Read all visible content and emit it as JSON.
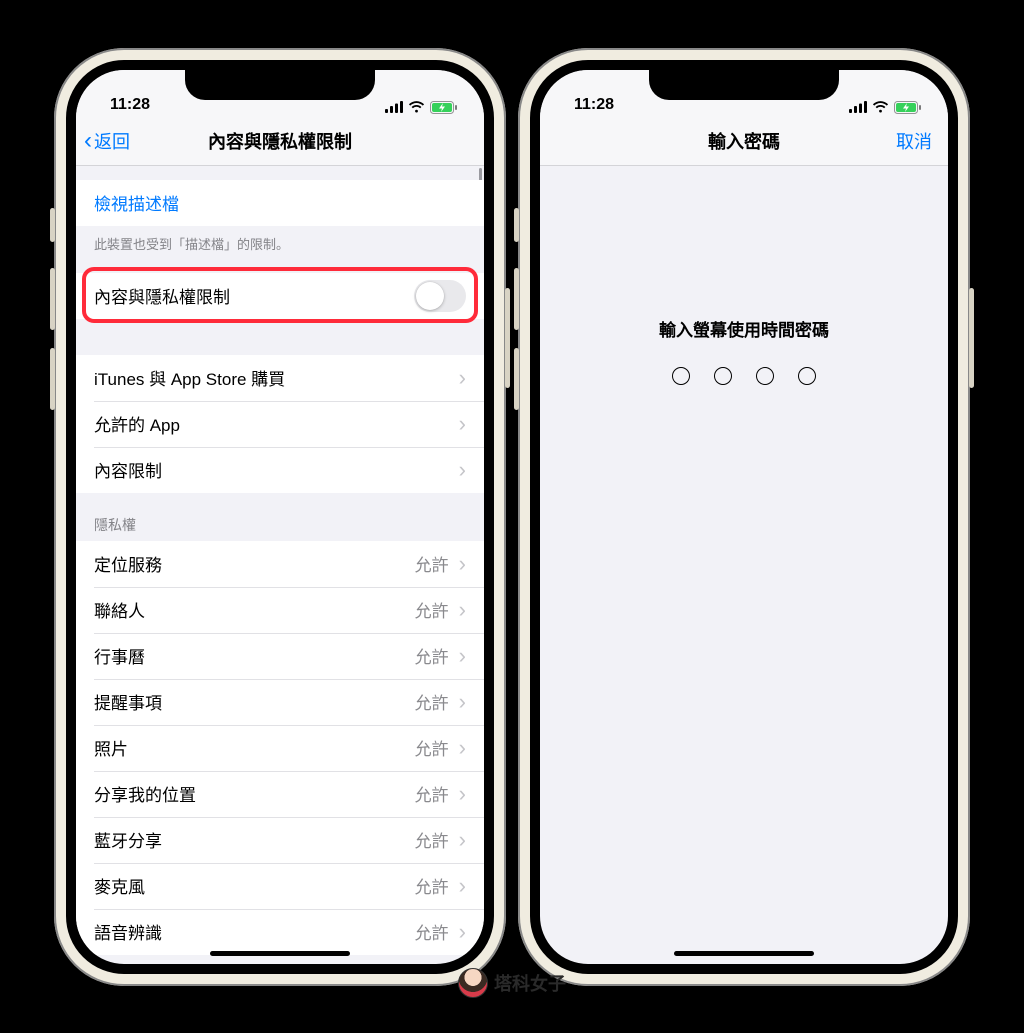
{
  "status": {
    "time": "11:28"
  },
  "left": {
    "nav": {
      "back": "返回",
      "title": "內容與隱私權限制"
    },
    "profile_link": "檢視描述檔",
    "profile_footer": "此裝置也受到「描述檔」的限制。",
    "toggle_label": "內容與隱私權限制",
    "section2": [
      {
        "label": "iTunes 與 App Store 購買"
      },
      {
        "label": "允許的 App"
      },
      {
        "label": "內容限制"
      }
    ],
    "privacy_header": "隱私權",
    "allow_value": "允許",
    "privacy_items": [
      {
        "label": "定位服務"
      },
      {
        "label": "聯絡人"
      },
      {
        "label": "行事曆"
      },
      {
        "label": "提醒事項"
      },
      {
        "label": "照片"
      },
      {
        "label": "分享我的位置"
      },
      {
        "label": "藍牙分享"
      },
      {
        "label": "麥克風"
      },
      {
        "label": "語音辨識"
      }
    ]
  },
  "right": {
    "nav": {
      "title": "輸入密碼",
      "cancel": "取消"
    },
    "prompt": "輸入螢幕使用時間密碼"
  },
  "watermark": "塔科女子"
}
